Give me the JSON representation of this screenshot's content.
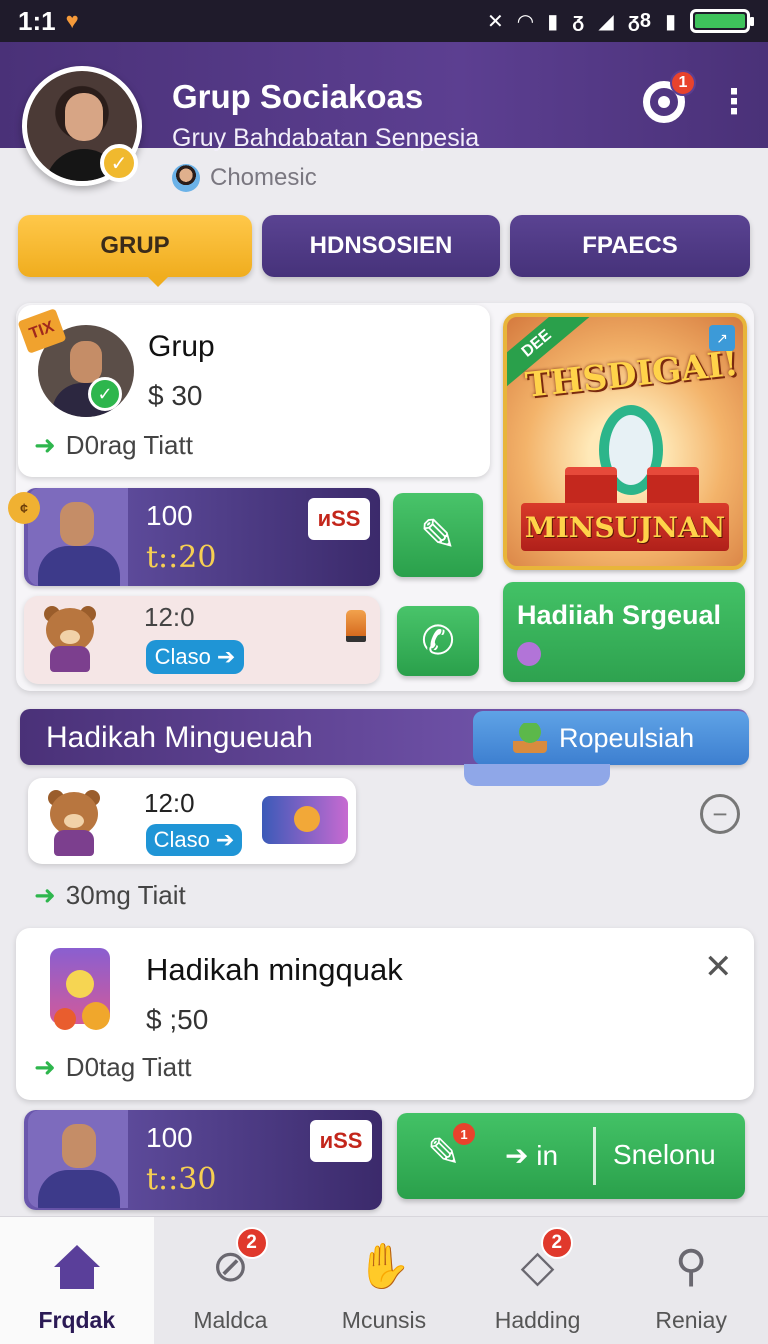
{
  "status_bar": {
    "time": "1:1",
    "signal_text": "ᵹ",
    "network_text": "ᵹ8"
  },
  "header": {
    "title": "Grup Sociakoas",
    "subtitle": "Gruy Bahdabatan Senpesia",
    "member_text": "Chomesic",
    "notification_count": "1"
  },
  "tabs": [
    {
      "label": "GRUP",
      "active": true
    },
    {
      "label": "HDNSOSIEN",
      "active": false
    },
    {
      "label": "FPAECS",
      "active": false
    }
  ],
  "card_grup": {
    "tag": "TIX",
    "title": "Grup",
    "price": "$ 30",
    "drag_text": "D0rag  Tiatt"
  },
  "card_purple_1": {
    "value": "100",
    "time": "t::20",
    "badge": "ᴎSS"
  },
  "card_bear_1": {
    "value": "12:0",
    "button": "Claso"
  },
  "promo": {
    "corner_tag": "DEE",
    "headline": "THSDIGAI!",
    "banner": "MINSUJNAN",
    "green_label": "Hadiiah Srgeual"
  },
  "section": {
    "title": "Hadikah Mingueuah",
    "button": "Ropeulsiah"
  },
  "card_bear_2": {
    "value": "12:0",
    "button": "Claso"
  },
  "drag_row_2": "30mg  Tiait",
  "card_hadikah": {
    "title": "Hadikah mingquak",
    "price": "$ ;50",
    "drag_text": "D0tag  Tiatt"
  },
  "card_purple_2": {
    "value": "100",
    "time": "t::30",
    "badge": "ᴎSS"
  },
  "wide_button": {
    "badge": "1",
    "left_label": "in",
    "right_label": "Snelonu"
  },
  "bottom_nav": [
    {
      "label": "Frqdak",
      "active": true,
      "badge": ""
    },
    {
      "label": "Maldca",
      "active": false,
      "badge": "2"
    },
    {
      "label": "Mcunsis",
      "active": false,
      "badge": ""
    },
    {
      "label": "Hadding",
      "active": false,
      "badge": "2"
    },
    {
      "label": "Reniay",
      "active": false,
      "badge": ""
    }
  ],
  "colors": {
    "header_purple": "#5c3f91",
    "accent_yellow": "#f0ad1e",
    "success_green": "#2eb64d",
    "info_blue": "#1f95d6",
    "badge_red": "#e0392c"
  }
}
